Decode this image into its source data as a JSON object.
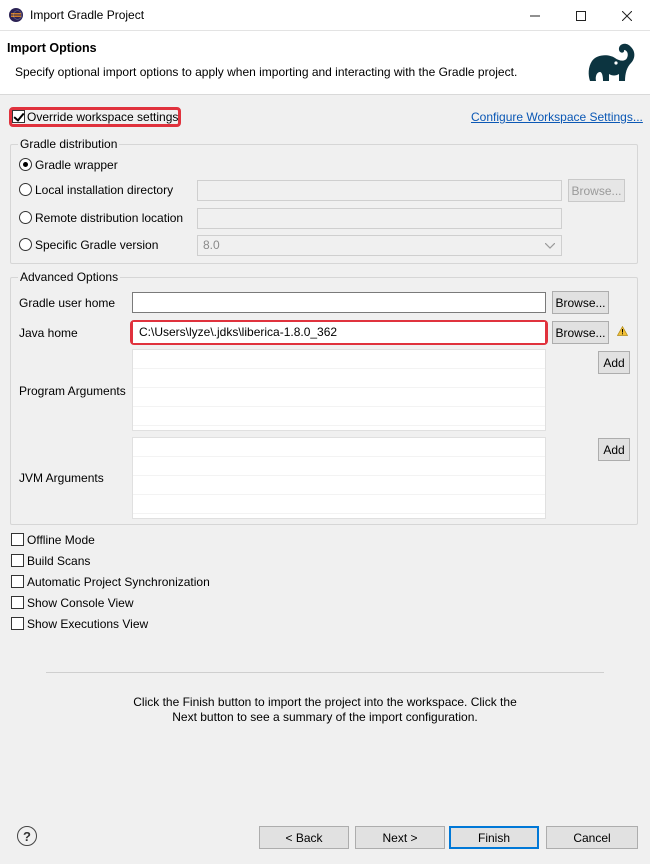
{
  "window": {
    "title": "Import Gradle Project",
    "minimize": "—",
    "maximize": "☐",
    "close": "✕"
  },
  "header": {
    "title": "Import Options",
    "description": "Specify optional import options to apply when importing and interacting with the Gradle project."
  },
  "override": {
    "label": "Override workspace settings",
    "checked": true
  },
  "configure_link": "Configure Workspace Settings...",
  "distribution": {
    "group_label": "Gradle distribution",
    "options": [
      {
        "label": "Gradle wrapper",
        "selected": true
      },
      {
        "label": "Local installation directory",
        "selected": false
      },
      {
        "label": "Remote distribution location",
        "selected": false
      },
      {
        "label": "Specific Gradle version",
        "selected": false
      }
    ],
    "browse_label": "Browse...",
    "version_value": "8.0"
  },
  "advanced": {
    "group_label": "Advanced Options",
    "gradle_user_home_label": "Gradle user home",
    "gradle_user_home_value": "",
    "java_home_label": "Java home",
    "java_home_value": "C:\\Users\\lyze\\.jdks\\liberica-1.8.0_362",
    "browse_label": "Browse...",
    "program_args_label": "Program Arguments",
    "jvm_args_label": "JVM Arguments",
    "add_label": "Add"
  },
  "options": [
    {
      "label": "Offline Mode",
      "checked": false
    },
    {
      "label": "Build Scans",
      "checked": false
    },
    {
      "label": "Automatic Project Synchronization",
      "checked": false
    },
    {
      "label": "Show Console View",
      "checked": false
    },
    {
      "label": "Show Executions View",
      "checked": false
    }
  ],
  "footer": {
    "line1": "Click the Finish button to import the project into the workspace. Click the",
    "line2": "Next button to see a summary of the import configuration.",
    "help": "?"
  },
  "buttons": {
    "back": "< Back",
    "next": "Next >",
    "finish": "Finish",
    "cancel": "Cancel"
  },
  "colors": {
    "highlight": "#e0323d",
    "link": "#0b58b5",
    "primary_border": "#0078d7"
  }
}
